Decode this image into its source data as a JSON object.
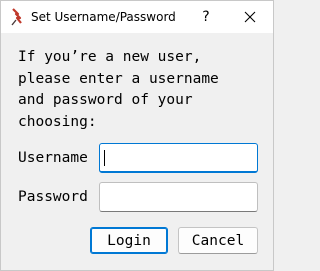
{
  "window": {
    "title": "Set Username/Password",
    "icon": "feather-icon",
    "help_glyph": "?",
    "close_icon": "close-icon"
  },
  "message": {
    "text": "If you’re a new user,\nplease enter a username\nand password of your\nchoosing:"
  },
  "form": {
    "username_label": "Username",
    "username_value": "",
    "password_label": "Password",
    "password_value": ""
  },
  "buttons": {
    "login_label": "Login",
    "cancel_label": "Cancel"
  },
  "colors": {
    "accent": "#0078d4",
    "icon_red": "#c0392b",
    "background": "#f0f0f0"
  }
}
